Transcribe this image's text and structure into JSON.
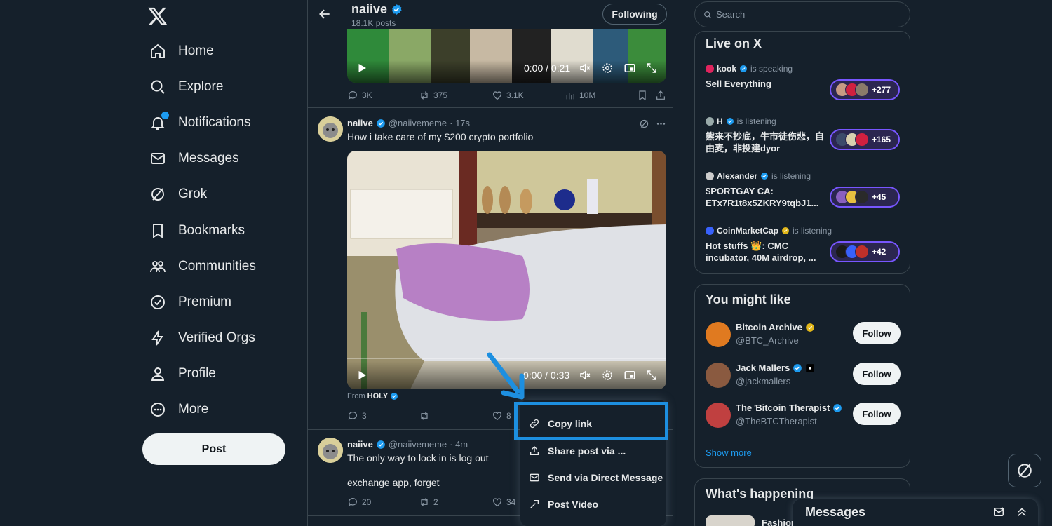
{
  "colors": {
    "bg": "#15202b",
    "accent": "#1d9bf0",
    "border": "#38444d",
    "highlight": "#1d8fe0",
    "space_purple": "#7856ff"
  },
  "nav": {
    "items": [
      {
        "label": "Home",
        "icon": "home-icon"
      },
      {
        "label": "Explore",
        "icon": "search-icon"
      },
      {
        "label": "Notifications",
        "icon": "bell-icon"
      },
      {
        "label": "Messages",
        "icon": "envelope-icon"
      },
      {
        "label": "Grok",
        "icon": "grok-icon"
      },
      {
        "label": "Bookmarks",
        "icon": "bookmark-icon"
      },
      {
        "label": "Communities",
        "icon": "communities-icon"
      },
      {
        "label": "Premium",
        "icon": "premium-icon"
      },
      {
        "label": "Verified Orgs",
        "icon": "lightning-icon"
      },
      {
        "label": "Profile",
        "icon": "person-icon"
      },
      {
        "label": "More",
        "icon": "more-circle-icon"
      }
    ],
    "post_label": "Post"
  },
  "header": {
    "name": "naiive",
    "posts": "18.1K posts",
    "following_label": "Following"
  },
  "video1": {
    "time": "0:00 / 0:21"
  },
  "tweet1_actions": {
    "replies": "3K",
    "reposts": "375",
    "likes": "3.1K",
    "views": "10M"
  },
  "tweet2": {
    "name": "naiive",
    "handle": "@naiivememe",
    "time": "· 17s",
    "text": "How i take care of my $200 crypto portfolio",
    "video_time": "0:00 / 0:33",
    "from_prefix": "From",
    "from_name": "HOLY",
    "replies": "3",
    "likes": "8"
  },
  "tweet3": {
    "name": "naiive",
    "handle": "@naiivememe",
    "time": "· 4m",
    "text1": "The only way to lock in is log out",
    "text2": "exchange app, forget",
    "replies": "20",
    "reposts": "2",
    "likes": "34"
  },
  "menu": {
    "items": [
      {
        "label": "Copy link",
        "icon": "link-icon"
      },
      {
        "label": "Share post via ...",
        "icon": "share-icon"
      },
      {
        "label": "Send via Direct Message",
        "icon": "envelope-icon"
      },
      {
        "label": "Post Video",
        "icon": "post-video-icon"
      }
    ]
  },
  "search": {
    "placeholder": "Search"
  },
  "live": {
    "title": "Live on X",
    "spaces": [
      {
        "host": "kook",
        "status": "is speaking",
        "title": "Sell Everything",
        "count": "+277"
      },
      {
        "host": "H",
        "status": "is listening",
        "title": "熊来不抄底，牛市徒伤悲，自由麦，非投建dyor",
        "count": "+165"
      },
      {
        "host": "Alexander",
        "status": "is listening",
        "title": "$PORTGAY CA: ETx7R1t8x5ZKRY9tqbJ1...",
        "count": "+45"
      },
      {
        "host": "CoinMarketCap",
        "status": "is listening",
        "title": "Hot stuffs 👑: CMC incubator, 40M airdrop, ...",
        "count": "+42"
      }
    ]
  },
  "might_like": {
    "title": "You might like",
    "users": [
      {
        "name": "Bitcoin Archive",
        "handle": "@BTC_Archive",
        "follow": "Follow"
      },
      {
        "name": "Jack Mallers",
        "handle": "@jackmallers",
        "follow": "Follow"
      },
      {
        "name": "The Ɓitcoin Therapist",
        "handle": "@TheBTCTherapist",
        "follow": "Follow"
      }
    ],
    "show_more": "Show more"
  },
  "happening": {
    "title": "What's happening",
    "item": "Fashion"
  },
  "messages_dock": {
    "title": "Messages"
  }
}
